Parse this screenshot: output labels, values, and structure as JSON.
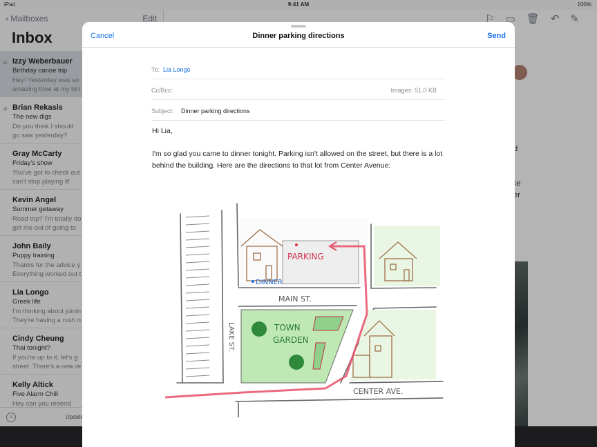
{
  "status_bar": {
    "device": "iPad",
    "time": "9:41 AM",
    "battery": "100%"
  },
  "sidebar": {
    "back_label": "Mailboxes",
    "edit_label": "Edit",
    "title": "Inbox",
    "messages": [
      {
        "from": "Izzy Weberbauer",
        "subject": "Birthday canoe trip",
        "preview": "Hey! Yesterday was so amazing time at my birt",
        "attachment": true,
        "selected": true
      },
      {
        "from": "Brian Rekasis",
        "subject": "The new digs",
        "preview": "Do you think I should go saw yesterday? Seems",
        "attachment": true,
        "selected": false
      },
      {
        "from": "Gray McCarty",
        "subject": "Friday's show",
        "preview": "You've got to check out can't stop playing it!",
        "attachment": false,
        "selected": false
      },
      {
        "from": "Kevin Angel",
        "subject": "Summer getaway",
        "preview": "Road trip? I'm totally do get me out of going to w",
        "attachment": false,
        "selected": false
      },
      {
        "from": "John Baily",
        "subject": "Puppy training",
        "preview": "Thanks for the advice y Everything worked out t",
        "attachment": false,
        "selected": false
      },
      {
        "from": "Lia Longo",
        "subject": "Greek life",
        "preview": "I'm thinking about joinin They're having a rush n",
        "attachment": false,
        "selected": false
      },
      {
        "from": "Cindy Cheung",
        "subject": "Thai tonight?",
        "preview": "If you're up to it, let's g street. There's a new re",
        "attachment": false,
        "selected": false
      },
      {
        "from": "Kelly Altick",
        "subject": "Five Alarm Chili",
        "preview": "Hey can you resend me",
        "attachment": false,
        "selected": false
      }
    ],
    "updated_label": "Update"
  },
  "detail_peek": {
    "line1": "nd",
    "line2": "like",
    "line3": "ner"
  },
  "compose": {
    "cancel_label": "Cancel",
    "title": "Dinner parking directions",
    "send_label": "Send",
    "to_label": "To:",
    "to_value": "Lia Longo",
    "cc_label": "Cc/Bcc:",
    "images_size": "Images: 51.0 KB",
    "subject_label": "Subject:",
    "subject_value": "Dinner parking directions",
    "greeting": "Hi Lia,",
    "body": "I'm so glad you came to dinner tonight. Parking isn't allowed on the street, but there is a lot behind the building. Here are the directions to that lot from Center Avenue:"
  },
  "map": {
    "parking_label": "PARKING",
    "dinner_label": "DINNER",
    "main_street": "MAIN ST.",
    "lake_street": "LAKE ST.",
    "garden_line1": "TOWN",
    "garden_line2": "GARDEN",
    "center_ave": "CENTER AVE.",
    "route_color": "#e8506a",
    "garden_color": "#bfe8b5"
  }
}
